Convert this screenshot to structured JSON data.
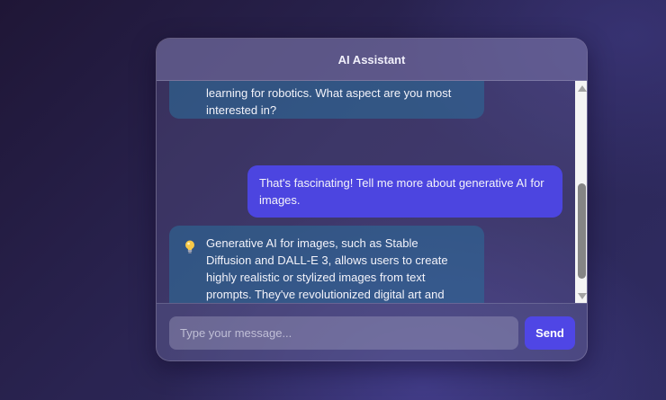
{
  "header": {
    "title": "AI Assistant"
  },
  "messages": [
    {
      "role": "assistant",
      "text": "learning for robotics. What aspect are you most interested in?"
    },
    {
      "role": "user",
      "text": "That's fascinating! Tell me more about generative AI for images."
    },
    {
      "role": "assistant",
      "icon": "lightbulb-icon",
      "text": "Generative AI for images, such as Stable Diffusion and DALL-E 3, allows users to create highly realistic or stylized images from text prompts. They've revolutionized digital art and content creation by enabling rapid prototyping and diverse visual outputs."
    }
  ],
  "composer": {
    "placeholder": "Type your message...",
    "value": "",
    "send_label": "Send"
  },
  "colors": {
    "user_bubble": "#4c45e0",
    "assistant_bubble": "#2d6996",
    "send_button": "#4f46e5"
  }
}
